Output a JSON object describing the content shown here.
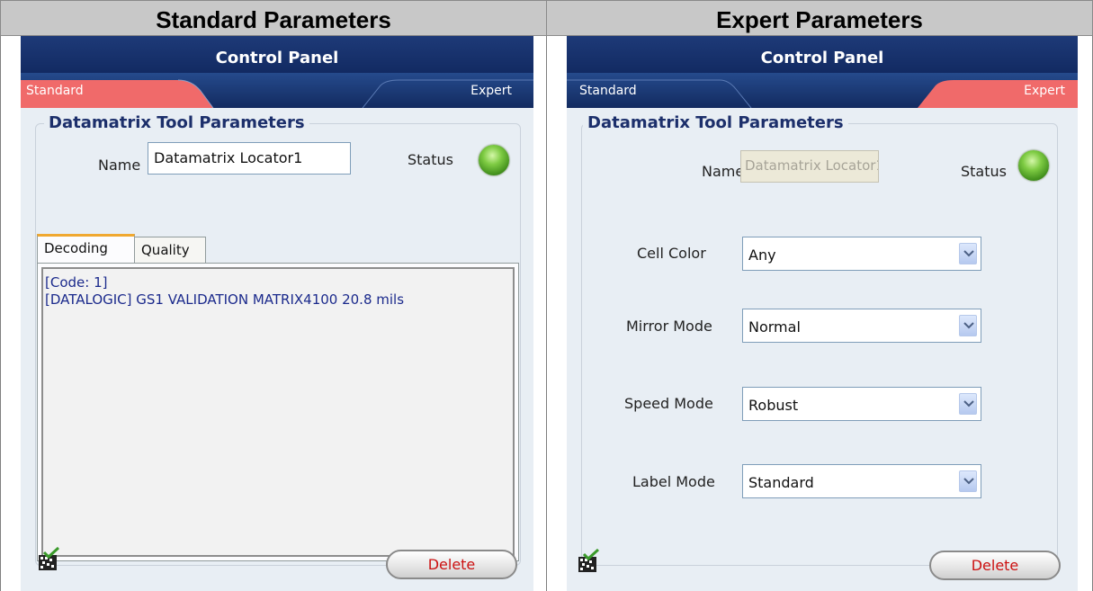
{
  "headers": {
    "standard": "Standard Parameters",
    "expert": "Expert Parameters"
  },
  "panel": {
    "title": "Control Panel",
    "tab_standard": "Standard",
    "tab_expert": "Expert",
    "section_title": "Datamatrix Tool Parameters",
    "name_label": "Name",
    "name_value": "Datamatrix Locator1",
    "status_label": "Status",
    "delete_label": "Delete"
  },
  "standard": {
    "inner_tabs": [
      "Decoding",
      "Quality"
    ],
    "active_inner_tab": "Decoding",
    "decoding_lines": [
      "[Code: 1]",
      "[DATALOGIC] GS1 VALIDATION MATRIX4100 20.8 mils"
    ]
  },
  "expert": {
    "fields": [
      {
        "label": "Cell Color",
        "value": "Any"
      },
      {
        "label": "Mirror Mode",
        "value": "Normal"
      },
      {
        "label": "Speed Mode",
        "value": "Robust"
      },
      {
        "label": "Label Mode",
        "value": "Standard"
      }
    ]
  },
  "colors": {
    "title_bar": "#1e3a78",
    "active_tab": "#f06a6a",
    "panel_bg": "#e8eef4",
    "status_led": "#7ecb43",
    "delete_text": "#cc1111"
  },
  "icons": [
    "datamatrix-tool-icon",
    "status-led-icon",
    "dropdown-arrow-icon"
  ]
}
